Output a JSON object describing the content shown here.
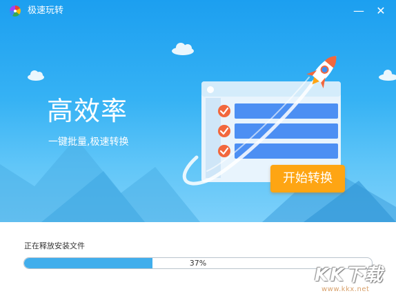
{
  "window": {
    "title": "极速玩转",
    "minimize_symbol": "—",
    "close_symbol": "✕",
    "logo_icon": "pinwheel-logo"
  },
  "hero": {
    "headline": "高效率",
    "subline": "一键批量,极速转换",
    "start_button": "开始转换",
    "colors": {
      "sky_top": "#1c9ff0",
      "sky_bottom": "#7dd0fa",
      "button": "#fea513",
      "list_bar": "#4c8ff3",
      "check": "#f2683d"
    }
  },
  "install": {
    "status_text": "正在释放安装文件",
    "progress_percent": 37,
    "progress_label": "37%",
    "fill_color": "#41aeec"
  },
  "watermark": {
    "brand": "KK下载",
    "url": "www.kkx.net"
  }
}
